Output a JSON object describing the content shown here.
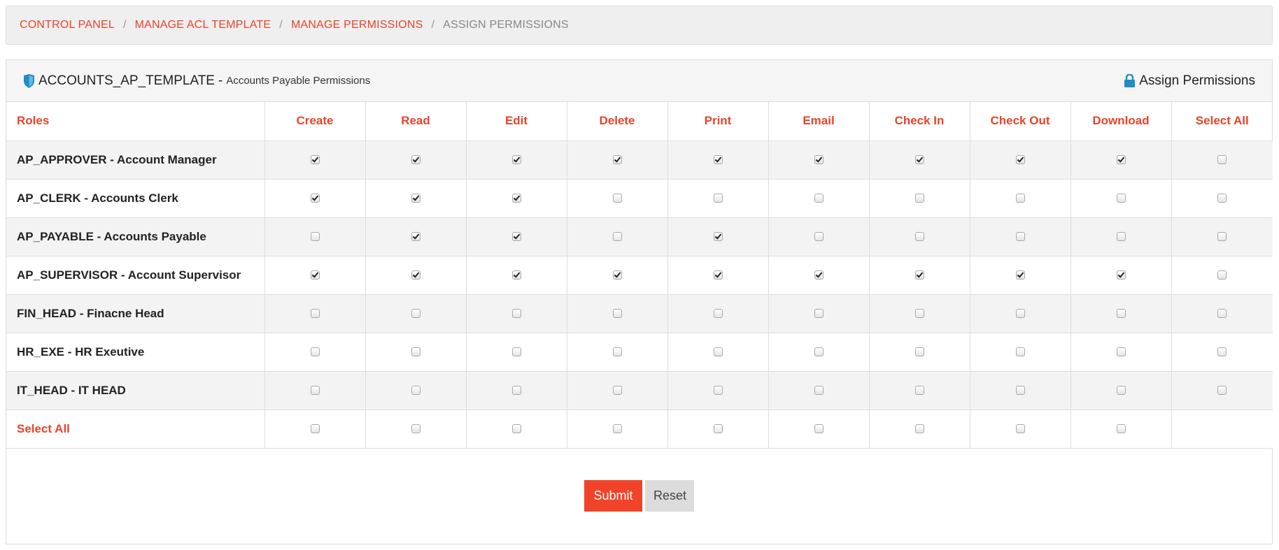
{
  "breadcrumb": {
    "items": [
      "CONTROL PANEL",
      "MANAGE ACL TEMPLATE",
      "MANAGE PERMISSIONS"
    ],
    "current": "ASSIGN PERMISSIONS",
    "separator": "/"
  },
  "panel": {
    "template_code": "ACCOUNTS_AP_TEMPLATE",
    "title_separator": "-",
    "template_desc": "Accounts Payable Permissions",
    "action_title": "Assign Permissions"
  },
  "table": {
    "roles_header": "Roles",
    "columns": [
      "Create",
      "Read",
      "Edit",
      "Delete",
      "Print",
      "Email",
      "Check In",
      "Check Out",
      "Download",
      "Select All"
    ],
    "rows": [
      {
        "role": "AP_APPROVER - Account Manager",
        "checks": [
          true,
          true,
          true,
          true,
          true,
          true,
          true,
          true,
          true,
          false
        ]
      },
      {
        "role": "AP_CLERK - Accounts Clerk",
        "checks": [
          true,
          true,
          true,
          false,
          false,
          false,
          false,
          false,
          false,
          false
        ]
      },
      {
        "role": "AP_PAYABLE - Accounts Payable",
        "checks": [
          false,
          true,
          true,
          false,
          true,
          false,
          false,
          false,
          false,
          false
        ]
      },
      {
        "role": "AP_SUPERVISOR - Account Supervisor",
        "checks": [
          true,
          true,
          true,
          true,
          true,
          true,
          true,
          true,
          true,
          false
        ]
      },
      {
        "role": "FIN_HEAD - Finacne Head",
        "checks": [
          false,
          false,
          false,
          false,
          false,
          false,
          false,
          false,
          false,
          false
        ]
      },
      {
        "role": "HR_EXE - HR Exeutive",
        "checks": [
          false,
          false,
          false,
          false,
          false,
          false,
          false,
          false,
          false,
          false
        ]
      },
      {
        "role": "IT_HEAD - IT HEAD",
        "checks": [
          false,
          false,
          false,
          false,
          false,
          false,
          false,
          false,
          false,
          false
        ]
      }
    ],
    "select_all_label": "Select All",
    "select_all_checks": [
      false,
      false,
      false,
      false,
      false,
      false,
      false,
      false,
      false
    ]
  },
  "buttons": {
    "submit": "Submit",
    "reset": "Reset"
  },
  "colors": {
    "accent": "#e8442a",
    "shield": "#1f8ec7",
    "lock": "#1f8ec7"
  },
  "icons": {
    "panel_title": "shield-icon",
    "assign": "lock-icon"
  }
}
